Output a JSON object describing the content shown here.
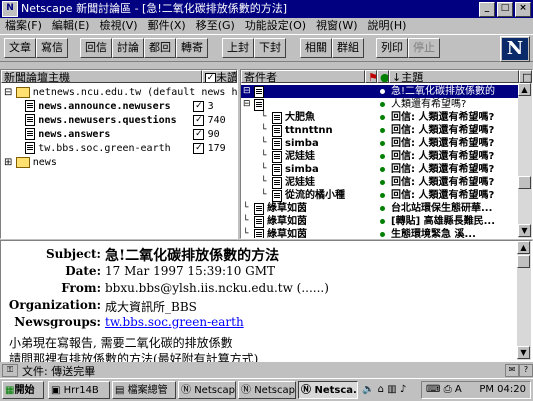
{
  "window": {
    "title": "Netscape 新聞討論區 - [急!二氧化碳排放係數的方法]",
    "icon": "N",
    "controls": [
      "_",
      "□",
      "×"
    ]
  },
  "menu": [
    "檔案(F)",
    "編輯(E)",
    "檢視(V)",
    "郵件(X)",
    "移至(G)",
    "功能設定(O)",
    "視窗(W)",
    "說明(H)"
  ],
  "toolbar": {
    "buttons": [
      "文章",
      "寫信",
      "回信",
      "討論",
      "都回",
      "轉寄",
      "上封",
      "下封",
      "相關",
      "群組",
      "列印",
      "停止"
    ],
    "disabled": [
      "停止"
    ],
    "logo": "N"
  },
  "folders": {
    "header_name": "新聞論壇主機",
    "header_unread": "未讀",
    "server": "netnews.ncu.edu.tw (default news host)",
    "groups": [
      {
        "name": "news.announce.newusers",
        "count": "3",
        "checked": true
      },
      {
        "name": "news.newusers.questions",
        "count": "740",
        "checked": true
      },
      {
        "name": "news.answers",
        "count": "90",
        "checked": true
      },
      {
        "name": "tw.bbs.soc.green-earth",
        "count": "179",
        "checked": true
      }
    ],
    "local_folder": "news"
  },
  "threads": {
    "header_sender": "寄件者",
    "header_subject": "主題",
    "rows": [
      {
        "sender": "",
        "subject": "急!二氧化碳排放係數的",
        "bold": false
      },
      {
        "sender": "",
        "subject": "人類還有希望嗎?",
        "bold": false
      },
      {
        "sender": "大肥魚",
        "subject": "回信: 人類還有希望嗎?",
        "bold": true
      },
      {
        "sender": "ttnnttnn",
        "subject": "回信: 人類還有希望嗎?",
        "bold": true
      },
      {
        "sender": "simba",
        "subject": "回信: 人類還有希望嗎?",
        "bold": true
      },
      {
        "sender": "泥娃娃",
        "subject": "回信: 人類還有希望嗎?",
        "bold": true
      },
      {
        "sender": "simba",
        "subject": "回信: 人類還有希望嗎?",
        "bold": true
      },
      {
        "sender": "泥娃娃",
        "subject": "回信: 人類還有希望嗎?",
        "bold": true
      },
      {
        "sender": "從流的橘小種",
        "subject": "回信: 人類還有希望嗎?",
        "bold": true
      },
      {
        "sender": "綠草如茵",
        "subject": "台北站環保生態研華...",
        "bold": true
      },
      {
        "sender": "綠草如茵",
        "subject": "[轉貼] 高雄縣長難民...",
        "bold": true
      },
      {
        "sender": "綠草如茵",
        "subject": "生態環境緊急 溪...",
        "bold": true
      }
    ]
  },
  "message": {
    "subject_label": "Subject:",
    "subject": "急!二氧化碳排放係數的方法",
    "date_label": "Date:",
    "date": "17 Mar 1997 15:39:10 GMT",
    "from_label": "From:",
    "from": "bbxu.bbs@ylsh.iis.ncku.edu.tw (......)",
    "org_label": "Organization:",
    "org": "成大資訊所_BBS",
    "groups_label": "Newsgroups:",
    "groups": "tw.bbs.soc.green-earth",
    "body1": "小弟現在寫報告, 需要二氧化碳的排放係數",
    "body2": "請問那裡有排放係數的方法(最好附有計算方式)"
  },
  "status": {
    "text": "文件: 傳送完畢"
  },
  "taskbar": {
    "start": "開始",
    "tasks": [
      "Hrr14B",
      "檔案總管",
      "Netscap",
      "Netscap",
      "Netsca..."
    ],
    "clock": "PM 04:20"
  },
  "colors": {
    "titlebar": "#000080",
    "desktop": "#008080",
    "link": "#0000ff"
  }
}
